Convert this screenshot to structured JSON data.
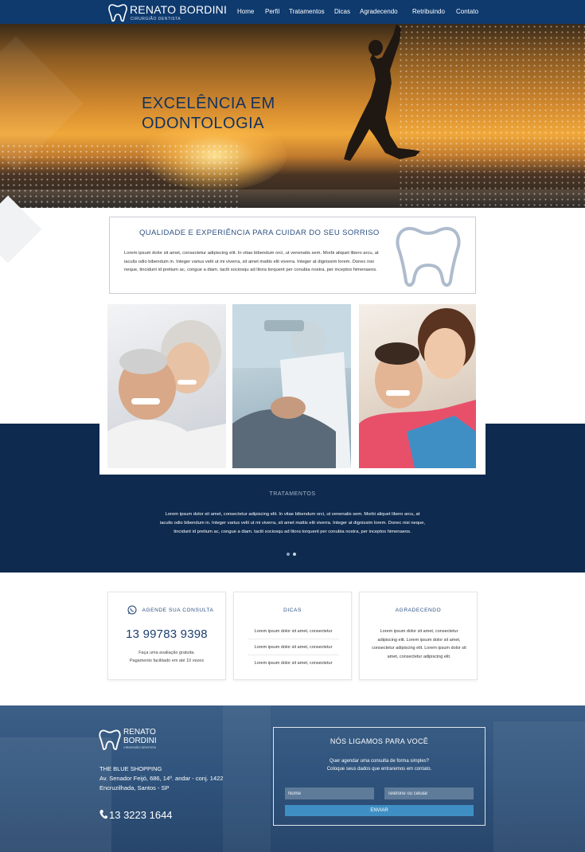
{
  "brand": {
    "name": "RENATO BORDINI",
    "name_line1": "RENATO",
    "name_line2": "BORDINI",
    "subtitle": "CIRURGIÃO DENTISTA"
  },
  "nav": {
    "items": [
      "Home",
      "Perfil",
      "Tratamentos",
      "Dicas",
      "Agradecendo",
      "Retribuindo",
      "Contato"
    ]
  },
  "hero": {
    "title_line1": "EXCELÊNCIA EM",
    "title_line2": "ODONTOLOGIA"
  },
  "intro": {
    "title": "QUALIDADE E EXPERIÊNCIA PARA CUIDAR DO SEU SORRISO",
    "text": "Lorem ipsum dolor sit amet, consectetur adipiscing elit. In vitae bibendum orci, ut venenatis sem. Morbi aliquet libero arcu, at iaculis odio bibendum in. Integer varius velit ut mi viverra, sit amet mattis elit viverra. Integer at dignissim lorem. Donec nisi neque, tincidunt id pretium ac, congue a diam. taciti sociosqu ad litora torquent per conubia nostra, per inceptos himenaeos."
  },
  "tratamentos": {
    "title": "TRATAMENTOS",
    "text": "Lorem ipsum dolor sit amet, consectetur adipiscing elit. In vitae bibendum orci, ut venenatis sem. Morbi aliquet libero arcu, at iaculis odio bibendum in. Integer varius velit ut mi viverra, sit amet mattis elit viverra. Integer at dignissim lorem. Donec nisi neque, tincidunt id pretium ac, congue a diam. taciti sociosqu ad litora torquent per conubia nostra, per inceptos himenaeos."
  },
  "cards": {
    "agende": {
      "title": "AGENDE SUA CONSULTA",
      "phone": "13 99783 9398",
      "text_line1": "Faça uma avaliação gratuita.",
      "text_line2": "Pagamento facilitado em até 10 vezes"
    },
    "dicas": {
      "title": "DICAS",
      "items": [
        "Lorem ipsum dolor sit amet, consectetur",
        "Lorem ipsum dolor sit amet, consectetur",
        "Lorem ipsum dolor sit amet, consectetur"
      ]
    },
    "agradecendo": {
      "title": "AGRADECENDO",
      "text": "Lorem ipsum dolor sit amet, consectetur adipiscing elit. Lorem ipsum dolor sit amet, consectetur adipiscing elit. Lorem ipsum dolor sit amet, consectetur adipiscing elit."
    }
  },
  "footer": {
    "address_line1": "THE BLUE SHOPPING",
    "address_line2": "Av. Senador Feijó, 686, 14º. andar - conj. 1422",
    "address_line3": "Encruzilhada, Santos - SP",
    "phone": "13 3223 1644"
  },
  "contact_form": {
    "title": "NÓS LIGAMOS PARA VOCÊ",
    "text_line1": "Quer agendar uma consulta de forma simples?",
    "text_line2": "Coloque seus dados que entraremos em contato.",
    "name_placeholder": "Nome",
    "phone_placeholder": "Telefone ou celular",
    "submit_label": "ENVIAR"
  },
  "colors": {
    "nav": "#0e3a6e",
    "navy_band": "#0e2a4e",
    "accent_text": "#2b4f82",
    "button": "#3f8fc4"
  },
  "icons": {
    "logo": "tooth-icon",
    "agende": "whatsapp-icon",
    "footer_phone": "phone-icon"
  }
}
